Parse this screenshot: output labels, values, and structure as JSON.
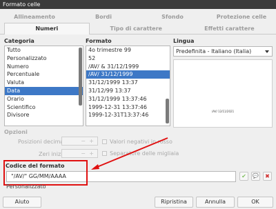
{
  "window": {
    "title": "Formato celle"
  },
  "tabs_row1": [
    "Allineamento",
    "Bordi",
    "Sfondo",
    "Protezione celle"
  ],
  "tabs_row2": [
    "Numeri",
    "Tipo di carattere",
    "Effetti carattere"
  ],
  "categoria": {
    "label": "Categoria",
    "items": [
      "Tutto",
      "Personalizzato",
      "Numero",
      "Percentuale",
      "Valuta",
      "Data",
      "Orario",
      "Scientifico",
      "Divisore"
    ],
    "selected": "Data"
  },
  "formato": {
    "label": "Formato",
    "items": [
      "4o trimestre 99",
      "52",
      "/AV/ & 31/12/1999",
      "/AV/ 31/12/1999",
      "31/12/1999 13:37",
      "31/12/99 13:37",
      "31/12/1999 13:37:46",
      "1999-12-31 13:37:46",
      "1999-12-31T13:37:46"
    ],
    "selected": "/AV/ 31/12/1999"
  },
  "lingua": {
    "label": "Lingua",
    "selected": "Predefinita - Italiano (Italia)"
  },
  "preview_text": "/AV/ 12/11/2021",
  "opzioni": {
    "label": "Opzioni",
    "decimali_label": "Posizioni decimali:",
    "zeri_label": "Zeri iniziali:",
    "negativi_label": "Valori negativi in rosso",
    "migliaia_label": "Separatore delle migliaia",
    "minus": "−",
    "plus": "+"
  },
  "codice": {
    "label": "Codice del formato",
    "value": "\"/AV/\" GG/MM/AAAA",
    "personalizzato": "Personalizzato",
    "ok_glyph": "✔",
    "comment_glyph": "💬",
    "delete_glyph": "✖"
  },
  "buttons": {
    "help": "Aiuto",
    "reset": "Ripristina",
    "cancel": "Annulla",
    "ok": "OK"
  },
  "colors": {
    "accent": "#3d78c6",
    "annotation": "#e01010"
  }
}
